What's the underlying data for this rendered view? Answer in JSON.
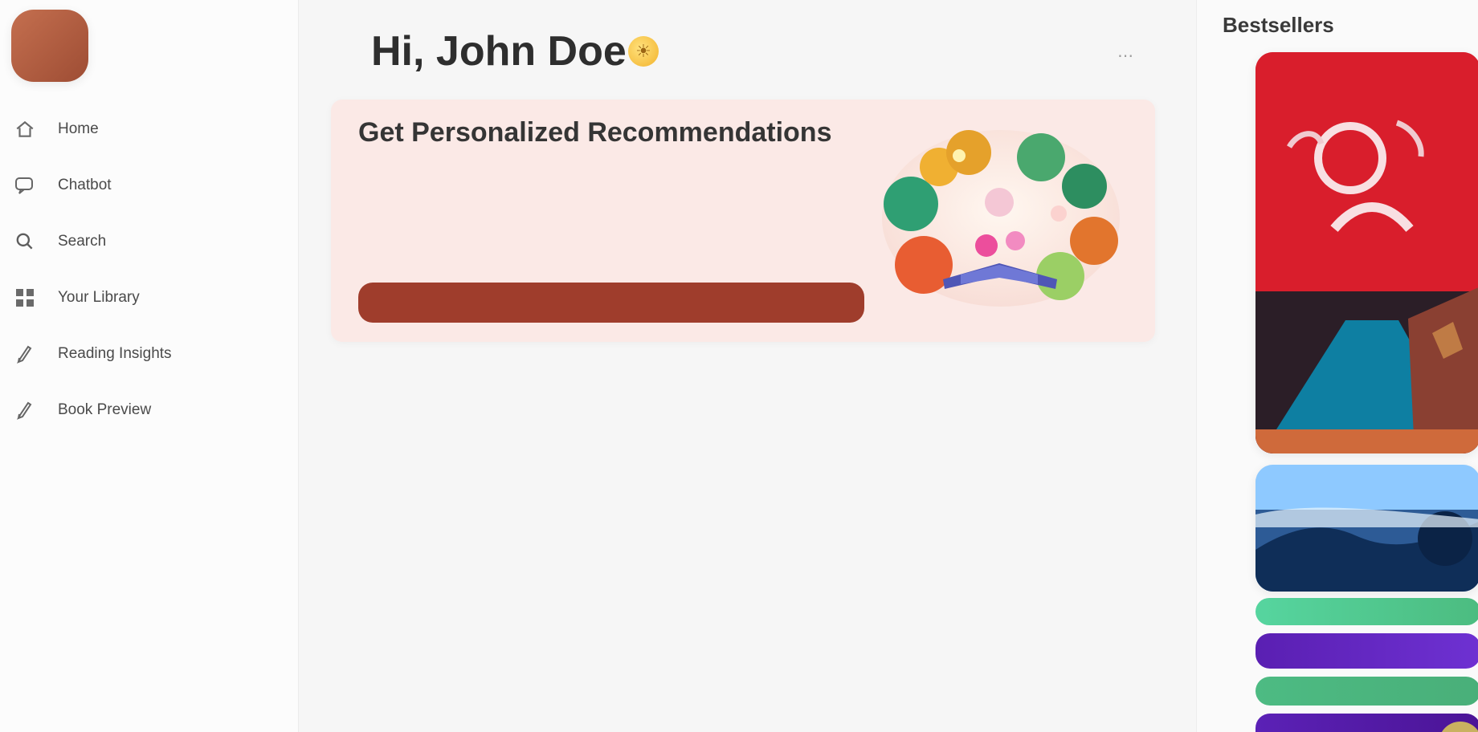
{
  "sidebar": {
    "brand_name": "",
    "items": [
      {
        "label": "Home",
        "icon": "home-icon"
      },
      {
        "label": "Chatbot",
        "icon": "chat-icon"
      },
      {
        "label": "Search",
        "icon": "search-icon"
      },
      {
        "label": "Your Library",
        "icon": "library-icon"
      },
      {
        "label": "Reading Insights",
        "icon": "pen-icon"
      },
      {
        "label": "Book Preview",
        "icon": "pen-icon"
      }
    ]
  },
  "main": {
    "greeting": "Hi, John Doe",
    "greeting_icon": "sun-icon",
    "header_action_icon": "dots-icon",
    "hero": {
      "title": "Get Personalized Recommendations",
      "body": "",
      "button_label": ""
    }
  },
  "right_panel": {
    "title": "Bestsellers"
  },
  "colors": {
    "accent": "#9f3d2c",
    "hero_bg": "#fbe9e6",
    "brand": "#b85e42"
  }
}
